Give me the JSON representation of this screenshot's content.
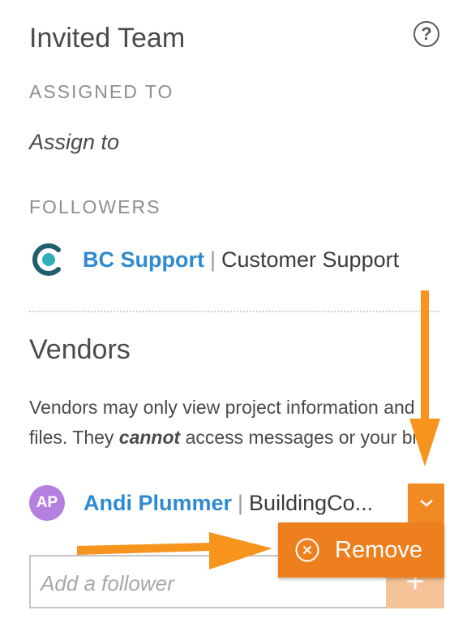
{
  "panel": {
    "title": "Invited Team",
    "help_icon": "question-circle-icon",
    "assigned_label": "ASSIGNED TO",
    "assign_placeholder": "Assign to",
    "followers_label": "FOLLOWERS",
    "follower": {
      "name": "BC Support",
      "separator": "|",
      "role": "Customer Support",
      "logo": "bc-logo"
    }
  },
  "vendors": {
    "title": "Vendors",
    "description_start": "Vendors may only view project information and files. They ",
    "description_emphasis": "cannot",
    "description_end": " access messages or your bid.",
    "vendor": {
      "initials": "AP",
      "name": "Andi Plummer",
      "separator": "|",
      "company": "BuildingCo..."
    },
    "dropdown_icon": "chevron-down-icon"
  },
  "menu": {
    "remove_label": "Remove",
    "remove_icon": "close-circle-icon"
  },
  "add_follower": {
    "placeholder": "Add a follower",
    "button_label": "+"
  },
  "colors": {
    "accent": "#f28a24",
    "link": "#2f8bd1",
    "avatar": "#b580e0",
    "arrow": "#f7941d"
  }
}
